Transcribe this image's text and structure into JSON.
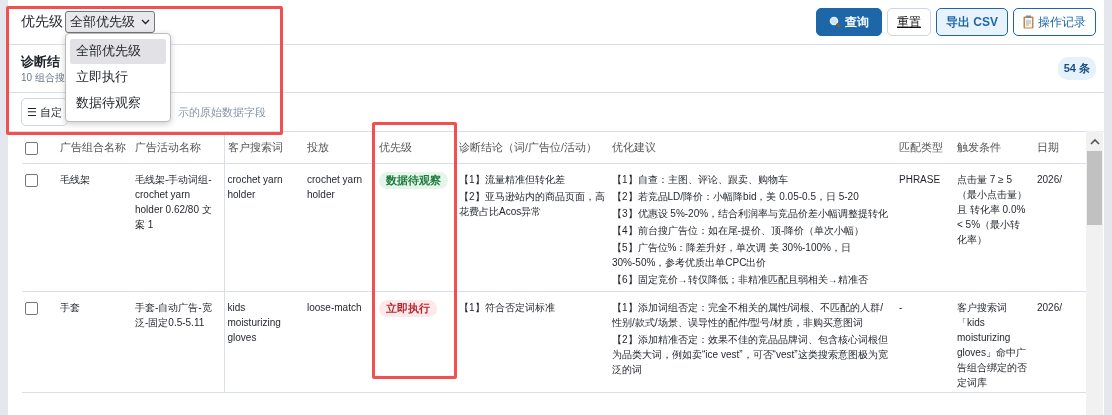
{
  "filter": {
    "label": "优先级",
    "select": {
      "value": "全部优先级",
      "expanded": true,
      "options": [
        {
          "label": "全部优先级",
          "selected": true
        },
        {
          "label": "立即执行",
          "selected": false
        },
        {
          "label": "数据待观察",
          "selected": false
        }
      ]
    }
  },
  "buttons": [
    {
      "label": "查询",
      "kind": "primary"
    },
    {
      "label": "重置",
      "kind": "plain"
    },
    {
      "label": "导出 CSV",
      "kind": "outline"
    },
    {
      "label": "操作记录",
      "kind": "history"
    }
  ],
  "results": {
    "title": "诊断结",
    "subtitle": "10 组合搜",
    "count": "54 条"
  },
  "toolbar": {
    "glyph": "☰",
    "button": "自定",
    "hint": "示的原始数据字段"
  },
  "table": {
    "header_checked": false,
    "columns": [
      "广告组合名称",
      "广告活动名称",
      "客户搜索词",
      "投放",
      "优先级",
      "诊断结论（词/广告位/活动）",
      "优化建议",
      "匹配类型",
      "触发条件",
      "日期"
    ],
    "rows": [
      {
        "checked": false,
        "group": "毛线架",
        "campaign": "毛线架-手动词组-crochet yarn holder 0.62/80 文案 1",
        "search_term": "crochet yarn holder",
        "targeting": "crochet yarn holder",
        "priority": {
          "label": "数据待观察",
          "kind": "observe"
        },
        "conclusions": [
          "【1】流量精准但转化差",
          "【2】亚马逊站内的商品页面，高花费占比Acos异常"
        ],
        "suggestions": [
          "【1】自查：主图、评论、跟卖、购物车",
          "【2】若竞品LD/降价：小幅降bid，美 0.05-0.5，日 5-20",
          "【3】优惠设 5%-20%，结合利润率与竞品价差小幅调整提转化",
          "【4】前台搜广告位：如在尾-提价、顶-降价（单次小幅）",
          "【5】广告位%：降差升好，单次调 美 30%-100%，日 30%-50%，参考优质出单CPC出价",
          "【6】固定竞价→转仅降低；非精准匹配且弱相关→精准否"
        ],
        "match_type": "PHRASE",
        "trigger": "点击量 7 ≥ 5（最小点击量）且 转化率 0.0% < 5%（最小转化率）",
        "date": "2026/"
      },
      {
        "checked": false,
        "group": "手套",
        "campaign": "手套-自动广告-宽泛-固定0.5-5.11",
        "search_term": "kids moisturizing gloves",
        "targeting": "loose-match",
        "priority": {
          "label": "立即执行",
          "kind": "execute"
        },
        "conclusions": [
          "【1】符合否定词标准"
        ],
        "suggestions": [
          "【1】添加词组否定：完全不相关的属性/词根、不匹配的人群/性别/款式/场景、误导性的配件/型号/材质，非购买意图词",
          "【2】添加精准否定：效果不佳的竞品品牌词、包含核心词根但为品类大词，例如卖“ice vest”，可否“vest”这类搜索意图极为宽泛的词"
        ],
        "match_type": "-",
        "trigger": "客户搜索词「kids moisturizing gloves」命中广告组合绑定的否定词库",
        "date": "2026/"
      }
    ]
  }
}
